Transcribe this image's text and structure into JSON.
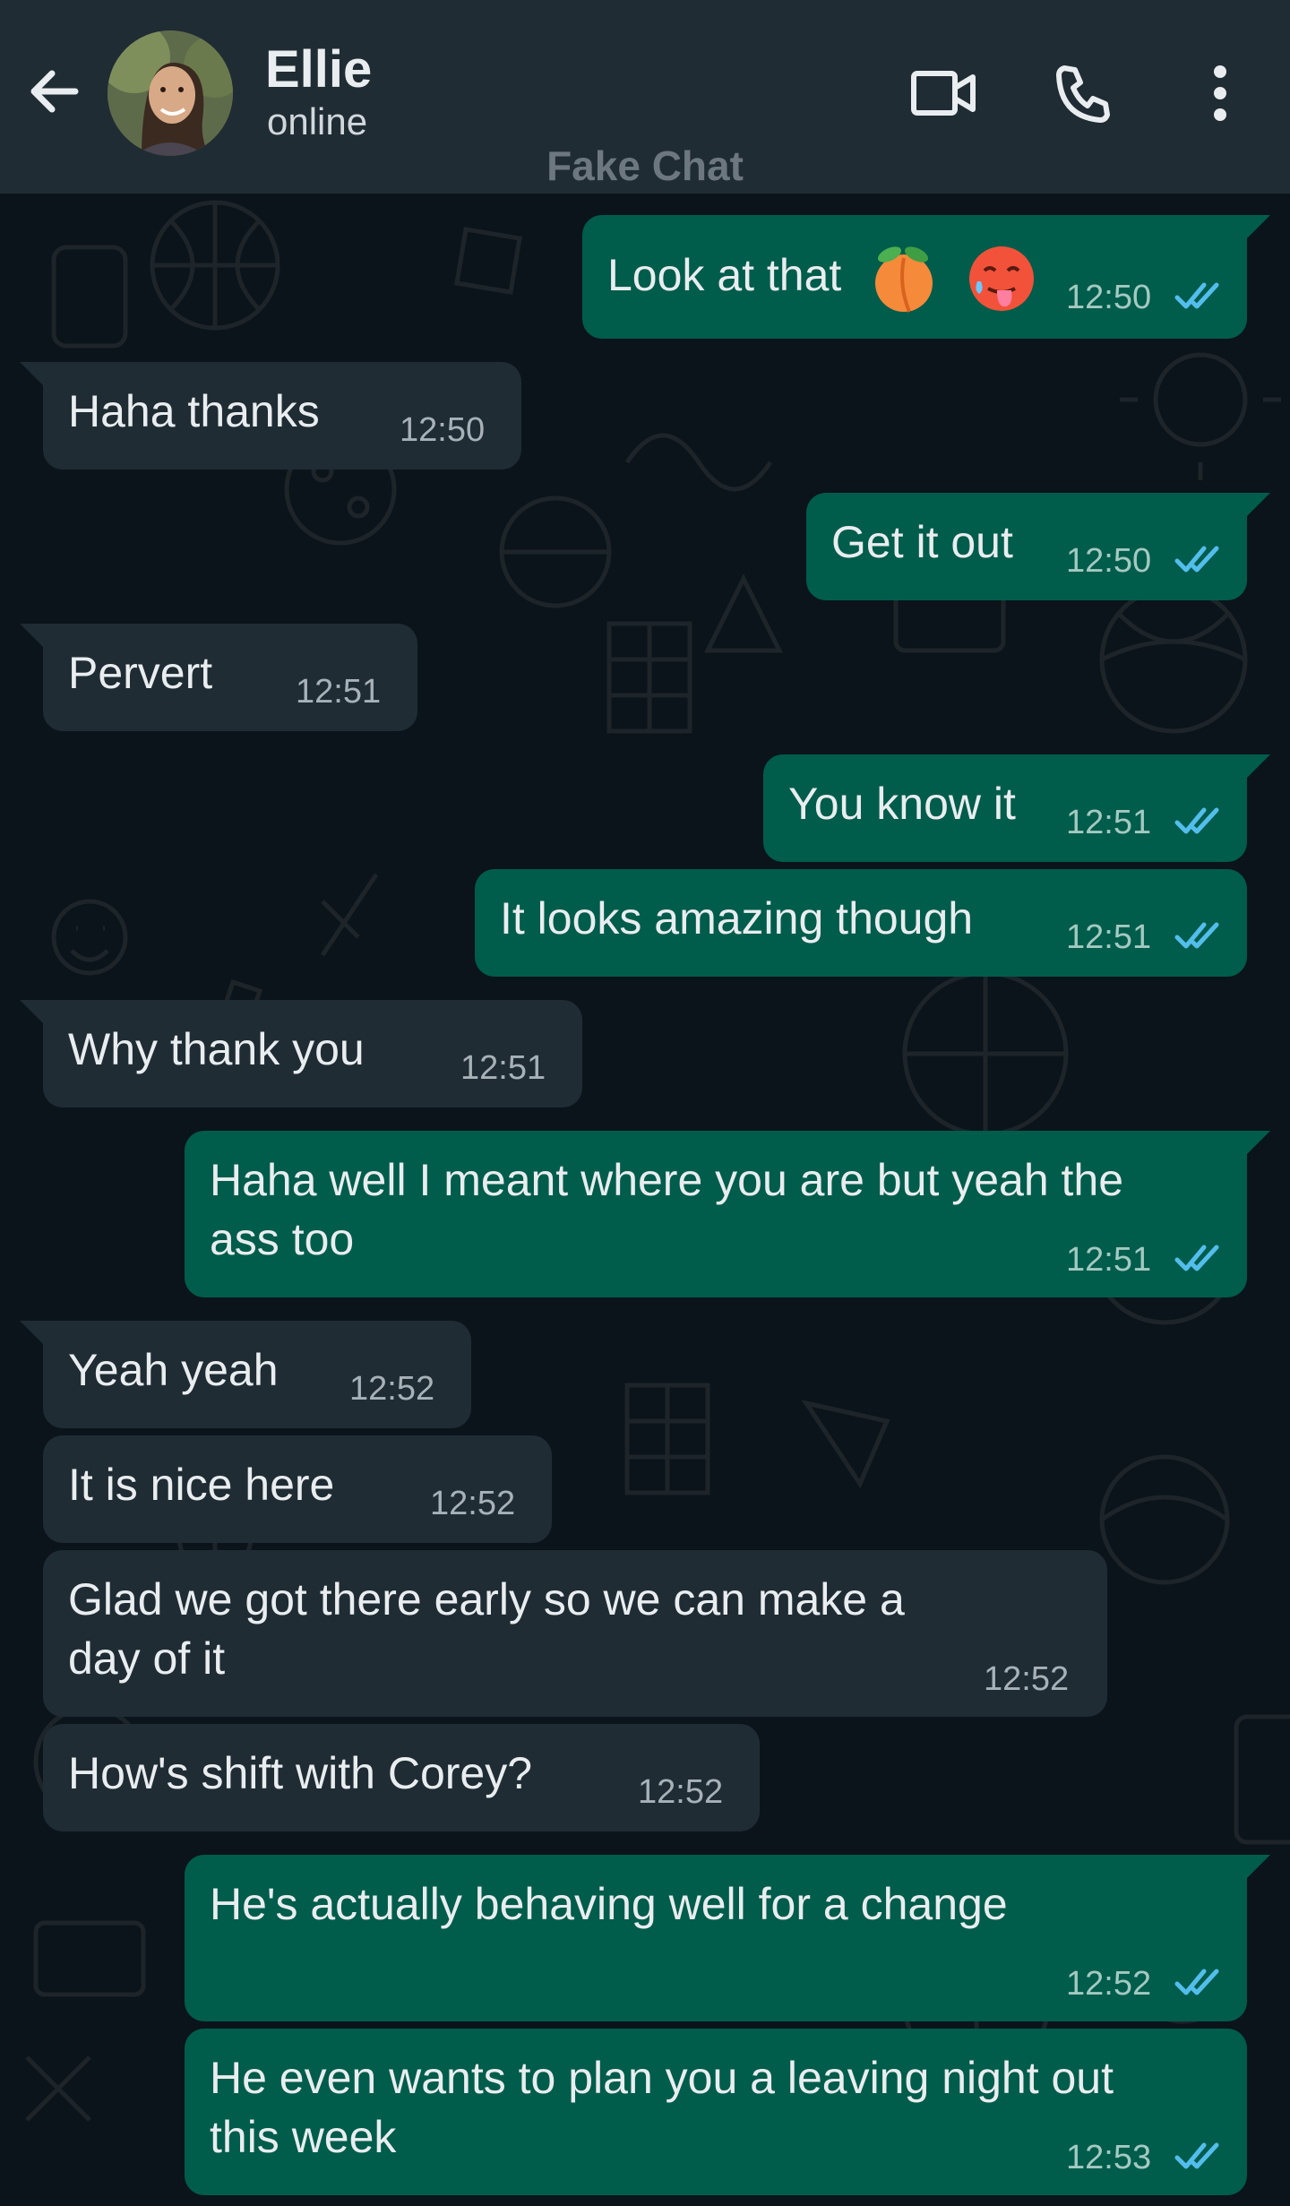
{
  "header": {
    "contact_name": "Ellie",
    "status": "online",
    "watermark": "Fake Chat",
    "icons": [
      "back-arrow-icon",
      "avatar",
      "video-call-icon",
      "phone-icon",
      "more-vertical-icon"
    ]
  },
  "colors": {
    "background": "#0b141a",
    "header": "#1f2c34",
    "incoming_bubble": "#1f2c34",
    "outgoing_bubble": "#005c4b",
    "read_ticks": "#53bdeb"
  },
  "messages": [
    {
      "dir": "out",
      "text": "Look at that",
      "emojis": [
        "peach-emoji",
        "hot-face-emoji"
      ],
      "time": "12:50",
      "read": true
    },
    {
      "dir": "in",
      "text": "Haha thanks",
      "time": "12:50"
    },
    {
      "dir": "out",
      "text": "Get it out",
      "time": "12:50",
      "read": true
    },
    {
      "dir": "in",
      "text": "Pervert",
      "time": "12:51"
    },
    {
      "dir": "out",
      "text": "You know it",
      "time": "12:51",
      "read": true
    },
    {
      "dir": "out",
      "text": "It looks amazing though",
      "time": "12:51",
      "read": true
    },
    {
      "dir": "in",
      "text": "Why thank you",
      "time": "12:51"
    },
    {
      "dir": "out",
      "lines": [
        "Haha well I meant where you are but yeah the",
        "ass too"
      ],
      "time": "12:51",
      "read": true
    },
    {
      "dir": "in",
      "text": "Yeah yeah",
      "time": "12:52"
    },
    {
      "dir": "in",
      "text": "It is nice here",
      "time": "12:52"
    },
    {
      "dir": "in",
      "lines": [
        "Glad we got there early so we can make a",
        "day of it"
      ],
      "time": "12:52"
    },
    {
      "dir": "in",
      "text": "How's shift with Corey?",
      "time": "12:52"
    },
    {
      "dir": "out",
      "text": "He's actually behaving well for a change",
      "time": "12:52",
      "read": true
    },
    {
      "dir": "out",
      "lines": [
        "He even wants to plan you a leaving night out",
        "this week"
      ],
      "time": "12:53",
      "read": true
    }
  ]
}
